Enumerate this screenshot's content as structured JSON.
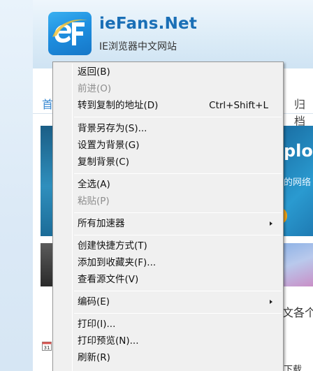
{
  "site": {
    "title": "ieFans.Net",
    "subtitle": "IE浏览器中文网站",
    "nav_home": "首",
    "nav_archive": "归档",
    "banner_big": "plore",
    "banner_small": "的网络",
    "bottom_text_1": "文各个",
    "bottom_text_2": "下载"
  },
  "context_menu": {
    "items": [
      {
        "label": "返回(B)",
        "shortcut": "",
        "disabled": false,
        "submenu": false
      },
      {
        "label": "前进(O)",
        "shortcut": "",
        "disabled": true,
        "submenu": false
      },
      {
        "label": "转到复制的地址(D)",
        "shortcut": "Ctrl+Shift+L",
        "disabled": false,
        "submenu": false
      },
      {
        "label": "背景另存为(S)...",
        "shortcut": "",
        "disabled": false,
        "submenu": false
      },
      {
        "label": "设置为背景(G)",
        "shortcut": "",
        "disabled": false,
        "submenu": false
      },
      {
        "label": "复制背景(C)",
        "shortcut": "",
        "disabled": false,
        "submenu": false
      },
      {
        "label": "全选(A)",
        "shortcut": "",
        "disabled": false,
        "submenu": false
      },
      {
        "label": "粘贴(P)",
        "shortcut": "",
        "disabled": true,
        "submenu": false
      },
      {
        "label": "所有加速器",
        "shortcut": "",
        "disabled": false,
        "submenu": true
      },
      {
        "label": "创建快捷方式(T)",
        "shortcut": "",
        "disabled": false,
        "submenu": false
      },
      {
        "label": "添加到收藏夹(F)...",
        "shortcut": "",
        "disabled": false,
        "submenu": false
      },
      {
        "label": "查看源文件(V)",
        "shortcut": "",
        "disabled": false,
        "submenu": false
      },
      {
        "label": "编码(E)",
        "shortcut": "",
        "disabled": false,
        "submenu": true
      },
      {
        "label": "打印(I)...",
        "shortcut": "",
        "disabled": false,
        "submenu": false
      },
      {
        "label": "打印预览(N)...",
        "shortcut": "",
        "disabled": false,
        "submenu": false
      },
      {
        "label": "刷新(R)",
        "shortcut": "",
        "disabled": false,
        "submenu": false
      }
    ]
  },
  "colors": {
    "menu_bg": "#f0f0f0",
    "disabled_text": "#8d8d8d",
    "brand_blue": "#1a6fb6"
  }
}
